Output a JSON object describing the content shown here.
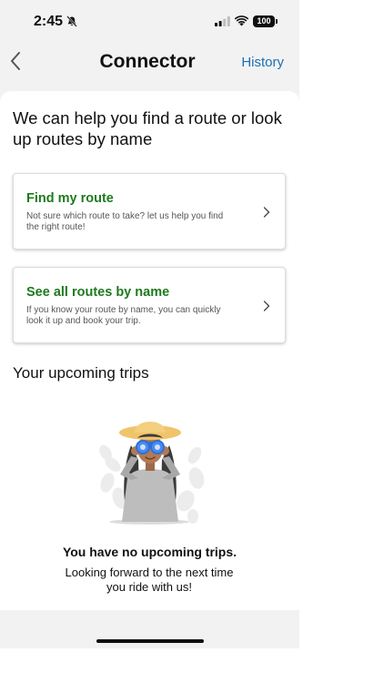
{
  "status_bar": {
    "time": "2:45",
    "battery": "100"
  },
  "nav": {
    "title": "Connector",
    "history_label": "History"
  },
  "main": {
    "headline": "We can help you find a route or look up routes by name",
    "cards": [
      {
        "title": "Find my route",
        "description": "Not sure which route to take? let us help you find the right route!"
      },
      {
        "title": "See all routes by name",
        "description": "If you know your route by name, you can quickly look it up and book your trip."
      }
    ],
    "upcoming_title": "Your upcoming trips",
    "empty_title": "You have no upcoming trips.",
    "empty_subtitle": "Looking forward to the next time you ride with us!"
  },
  "colors": {
    "accent_green": "#1e7a1e",
    "link_blue": "#1b6fb5"
  },
  "icons": {
    "back": "chevron-left-icon",
    "card_arrow": "chevron-right-icon",
    "silent": "bell-slash-icon",
    "illustration": "person-with-binoculars-illustration"
  }
}
